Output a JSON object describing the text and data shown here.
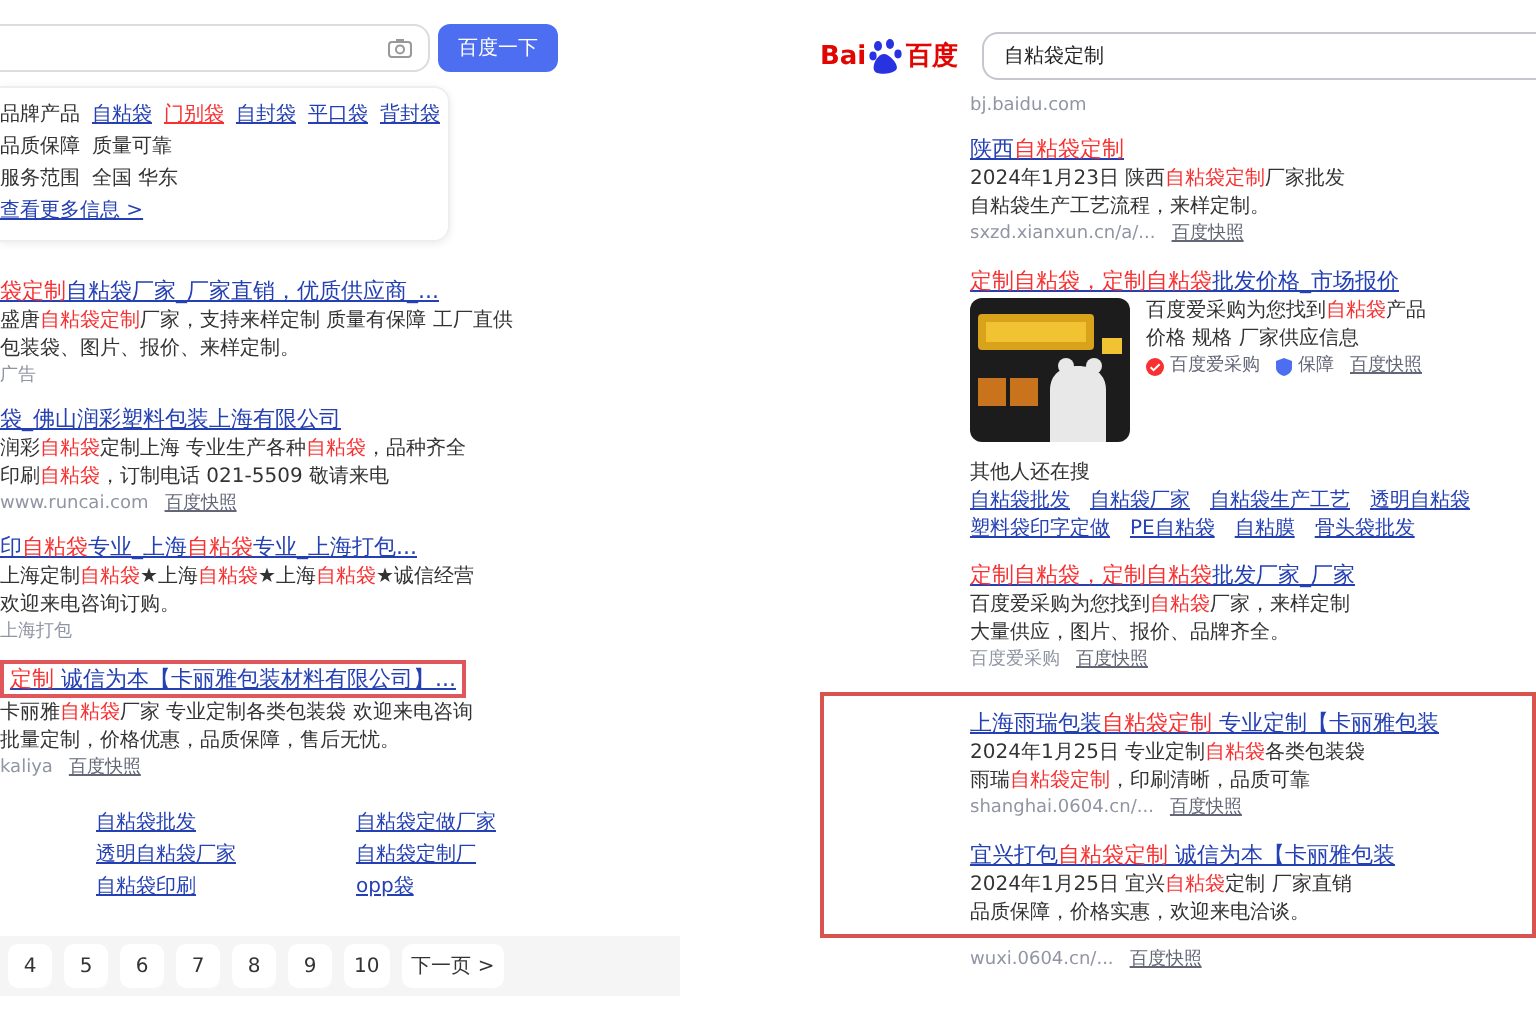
{
  "left": {
    "search_button": "百度一下",
    "suggestion": {
      "rows": [
        {
          "kind": "links",
          "label": "品牌产品",
          "items": [
            {
              "text": "自粘袋",
              "highlight": false
            },
            {
              "text": "门别袋",
              "highlight": true
            },
            {
              "text": "自封袋",
              "highlight": false
            },
            {
              "text": "平口袋",
              "highlight": false
            },
            {
              "text": "背封袋",
              "highlight": false
            }
          ]
        },
        {
          "kind": "text",
          "label": "品质保障",
          "text": "质量可靠"
        },
        {
          "kind": "text",
          "label": "服务范围",
          "text": "全国 华东"
        },
        {
          "kind": "more",
          "text": "查看更多信息 >"
        }
      ]
    },
    "results": [
      {
        "title": [
          {
            "text": "袋定制",
            "highlight": true
          },
          {
            "text": "自粘袋厂家_厂家直销，优质供应商_...",
            "highlight": false
          }
        ],
        "title_boxed": false,
        "snippet": [
          [
            {
              "text": "盛唐",
              "highlight": false
            },
            {
              "text": "自粘袋定制",
              "highlight": true
            },
            {
              "text": "厂家，支持来样定制 质量有保障 工厂直供",
              "highlight": false
            }
          ],
          [
            {
              "text": "包装袋、图片、报价、来样定制。",
              "highlight": false
            }
          ]
        ],
        "source": "广告"
      },
      {
        "title": [
          {
            "text": "袋_佛山润彩塑料包装上海有限公司",
            "highlight": false
          }
        ],
        "title_boxed": false,
        "snippet": [
          [
            {
              "text": "润彩",
              "highlight": false
            },
            {
              "text": "自粘袋",
              "highlight": true
            },
            {
              "text": "定制上海 专业生产各种",
              "highlight": false
            },
            {
              "text": "自粘袋",
              "highlight": true
            },
            {
              "text": "，品种齐全",
              "highlight": false
            }
          ],
          [
            {
              "text": "印刷",
              "highlight": false
            },
            {
              "text": "自粘袋",
              "highlight": true
            },
            {
              "text": "，订制电话 021-5509 敬请来电",
              "highlight": false
            }
          ]
        ],
        "source": "www.runcai.com",
        "snapshot": "百度快照"
      },
      {
        "title": [
          {
            "text": "印",
            "highlight": false
          },
          {
            "text": "自粘袋",
            "highlight": true
          },
          {
            "text": "专业_上海",
            "highlight": false
          },
          {
            "text": "自粘袋",
            "highlight": true
          },
          {
            "text": "专业_上海打包...",
            "highlight": false
          }
        ],
        "title_boxed": false,
        "snippet": [
          [
            {
              "text": "上海定制",
              "highlight": false
            },
            {
              "text": "自粘袋",
              "highlight": true
            },
            {
              "text": "★上海",
              "highlight": false
            },
            {
              "text": "自粘袋",
              "highlight": true
            },
            {
              "text": "★上海",
              "highlight": false
            },
            {
              "text": "自粘袋",
              "highlight": true
            },
            {
              "text": "★诚信经营",
              "highlight": false
            }
          ],
          [
            {
              "text": "欢迎来电咨询订购。",
              "highlight": false
            }
          ]
        ],
        "source": "上海打包"
      },
      {
        "title": [
          {
            "text": "定制",
            "highlight": true
          },
          {
            "text": " 诚信为本【卡丽雅包装材料有限公司】...",
            "highlight": false
          }
        ],
        "title_boxed": true,
        "snippet": [
          [
            {
              "text": "卡丽雅",
              "highlight": false
            },
            {
              "text": "自粘袋",
              "highlight": true
            },
            {
              "text": "厂家 专业定制各类包装袋 欢迎来电咨询",
              "highlight": false
            }
          ],
          [
            {
              "text": "批量定制，价格优惠，品质保障，售后无忧。",
              "highlight": false
            }
          ]
        ],
        "source": "kaliya",
        "snapshot": "百度快照"
      }
    ],
    "related": [
      "自粘袋批发",
      "自粘袋定做厂家",
      "透明自粘袋厂家",
      "自粘袋定制厂",
      "自粘袋印刷",
      "opp袋"
    ],
    "pagination": {
      "pages": [
        "4",
        "5",
        "6",
        "7",
        "8",
        "9",
        "10"
      ],
      "next": "下一页 >"
    }
  },
  "right": {
    "logo": {
      "latin": "Bai",
      "chinese": "百度"
    },
    "query": "自粘袋定制",
    "sections": [
      {
        "kind": "url",
        "text": "bj.baidu.com"
      },
      {
        "kind": "result",
        "title": [
          {
            "text": "陕西",
            "highlight": false
          },
          {
            "text": "自粘袋定制",
            "highlight": true
          }
        ],
        "snippet": [
          [
            {
              "text": "2024年1月23日 陕西",
              "highlight": false
            },
            {
              "text": "自粘袋定制",
              "highlight": true
            },
            {
              "text": "厂家批发",
              "highlight": false
            }
          ],
          [
            {
              "text": "自粘袋生产工艺流程，来样定制。",
              "highlight": false
            }
          ]
        ],
        "source": "sxzd.xianxun.cn/a/...",
        "snapshot": "百度快照"
      },
      {
        "kind": "image_result",
        "title": [
          {
            "text": "定制自粘袋，定制自粘袋",
            "highlight": true
          },
          {
            "text": "批发价格_市场报价",
            "highlight": false
          }
        ],
        "snippet": [
          [
            {
              "text": "百度爱采购为您找到",
              "highlight": false
            },
            {
              "text": "自粘袋",
              "highlight": true
            },
            {
              "text": "产品",
              "highlight": false
            }
          ],
          [
            {
              "text": "价格 规格 厂家供应信息",
              "highlight": false
            }
          ]
        ],
        "badges": [
          {
            "kind": "verified",
            "text": "百度爱采购"
          },
          {
            "kind": "shield",
            "text": "保障"
          }
        ],
        "snapshot": "百度快照"
      },
      {
        "kind": "related",
        "label": "其他人还在搜",
        "rows": [
          [
            "自粘袋批发",
            "自粘袋厂家",
            "自粘袋生产工艺",
            "透明自粘袋"
          ],
          [
            "塑料袋印字定做",
            "PE自粘袋",
            "自粘膜",
            "骨头袋批发"
          ]
        ]
      },
      {
        "kind": "result",
        "title": [
          {
            "text": "定制自粘袋，定制自粘袋",
            "highlight": true
          },
          {
            "text": "批发厂家_厂家",
            "highlight": false
          }
        ],
        "snippet": [
          [
            {
              "text": "百度爱采购为您找到",
              "highlight": false
            },
            {
              "text": "自粘袋",
              "highlight": true
            },
            {
              "text": "厂家，来样定制",
              "highlight": false
            }
          ],
          [
            {
              "text": "大量供应，图片、报价、品牌齐全。",
              "highlight": false
            }
          ]
        ],
        "source": "百度爱采购",
        "snapshot": "百度快照"
      },
      {
        "kind": "box",
        "results": [
          {
            "title": [
              {
                "text": "上海雨瑞包装",
                "highlight": false
              },
              {
                "text": "自粘袋定制",
                "highlight": true
              },
              {
                "text": " 专业定制【卡丽雅包装",
                "highlight": false
              }
            ],
            "snippet": [
              [
                {
                  "text": "2024年1月25日 专业定制",
                  "highlight": false
                },
                {
                  "text": "自粘袋",
                  "highlight": true
                },
                {
                  "text": "各类包装袋",
                  "highlight": false
                }
              ],
              [
                {
                  "text": "雨瑞",
                  "highlight": false
                },
                {
                  "text": "自粘袋定制",
                  "highlight": true
                },
                {
                  "text": "，印刷清晰，品质可靠",
                  "highlight": false
                }
              ]
            ],
            "source": "shanghai.0604.cn/...",
            "snapshot": "百度快照"
          },
          {
            "title": [
              {
                "text": "宜兴打包",
                "highlight": false
              },
              {
                "text": "自粘袋定制",
                "highlight": true
              },
              {
                "text": " 诚信为本【卡丽雅包装",
                "highlight": false
              }
            ],
            "snippet": [
              [
                {
                  "text": "2024年1月25日 宜兴",
                  "highlight": false
                },
                {
                  "text": "自粘袋",
                  "highlight": true
                },
                {
                  "text": "定制 厂家直销",
                  "highlight": false
                }
              ],
              [
                {
                  "text": "品质保障，价格实惠，欢迎来电洽谈。",
                  "highlight": false
                }
              ]
            ]
          }
        ]
      },
      {
        "kind": "source",
        "source": "wuxi.0604.cn/...",
        "snapshot": "百度快照"
      }
    ]
  }
}
